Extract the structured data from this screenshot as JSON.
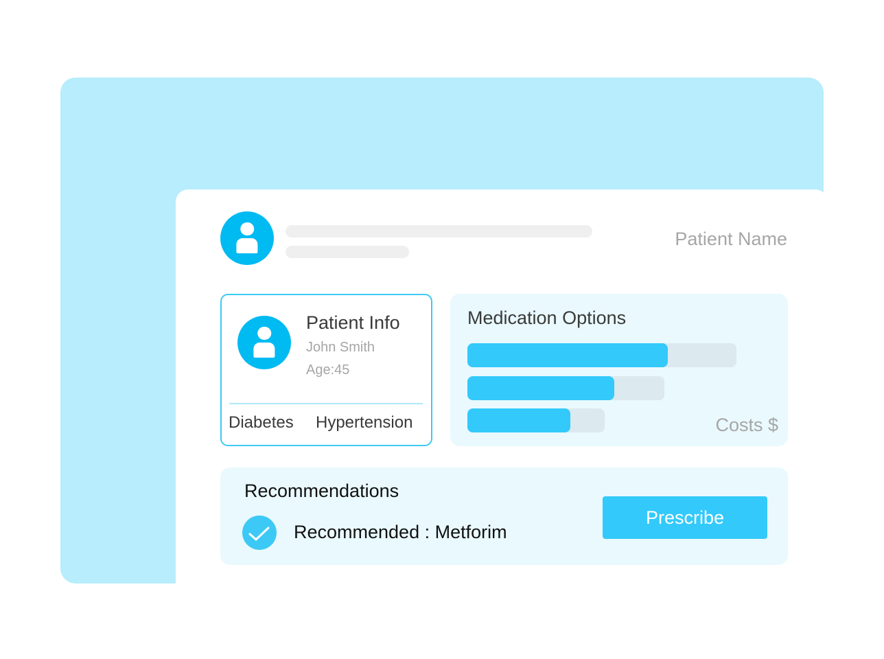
{
  "colors": {
    "frame": "#b7edfc",
    "accent": "#00baf2",
    "bar_fill": "#33c9fb",
    "bar_track": "#dce9ef",
    "panel": "#e9f9fe"
  },
  "header": {
    "avatar_icon": "user-icon",
    "patient_name_label": "Patient Name"
  },
  "patient_info": {
    "title": "Patient Info",
    "avatar_icon": "user-icon",
    "name": "John Smith",
    "age": "Age:45",
    "conditions": [
      "Diabetes",
      "Hypertension"
    ]
  },
  "medication": {
    "title": "Medication Options",
    "costs_label": "Costs $",
    "bars": [
      {
        "fill": 0.745
      },
      {
        "fill": 0.745
      },
      {
        "fill": 0.75
      }
    ]
  },
  "recommendations": {
    "title": "Recommendations",
    "check_icon": "check-circle-icon",
    "text": "Recommended : Metforim",
    "prescribe_label": "Prescribe"
  }
}
